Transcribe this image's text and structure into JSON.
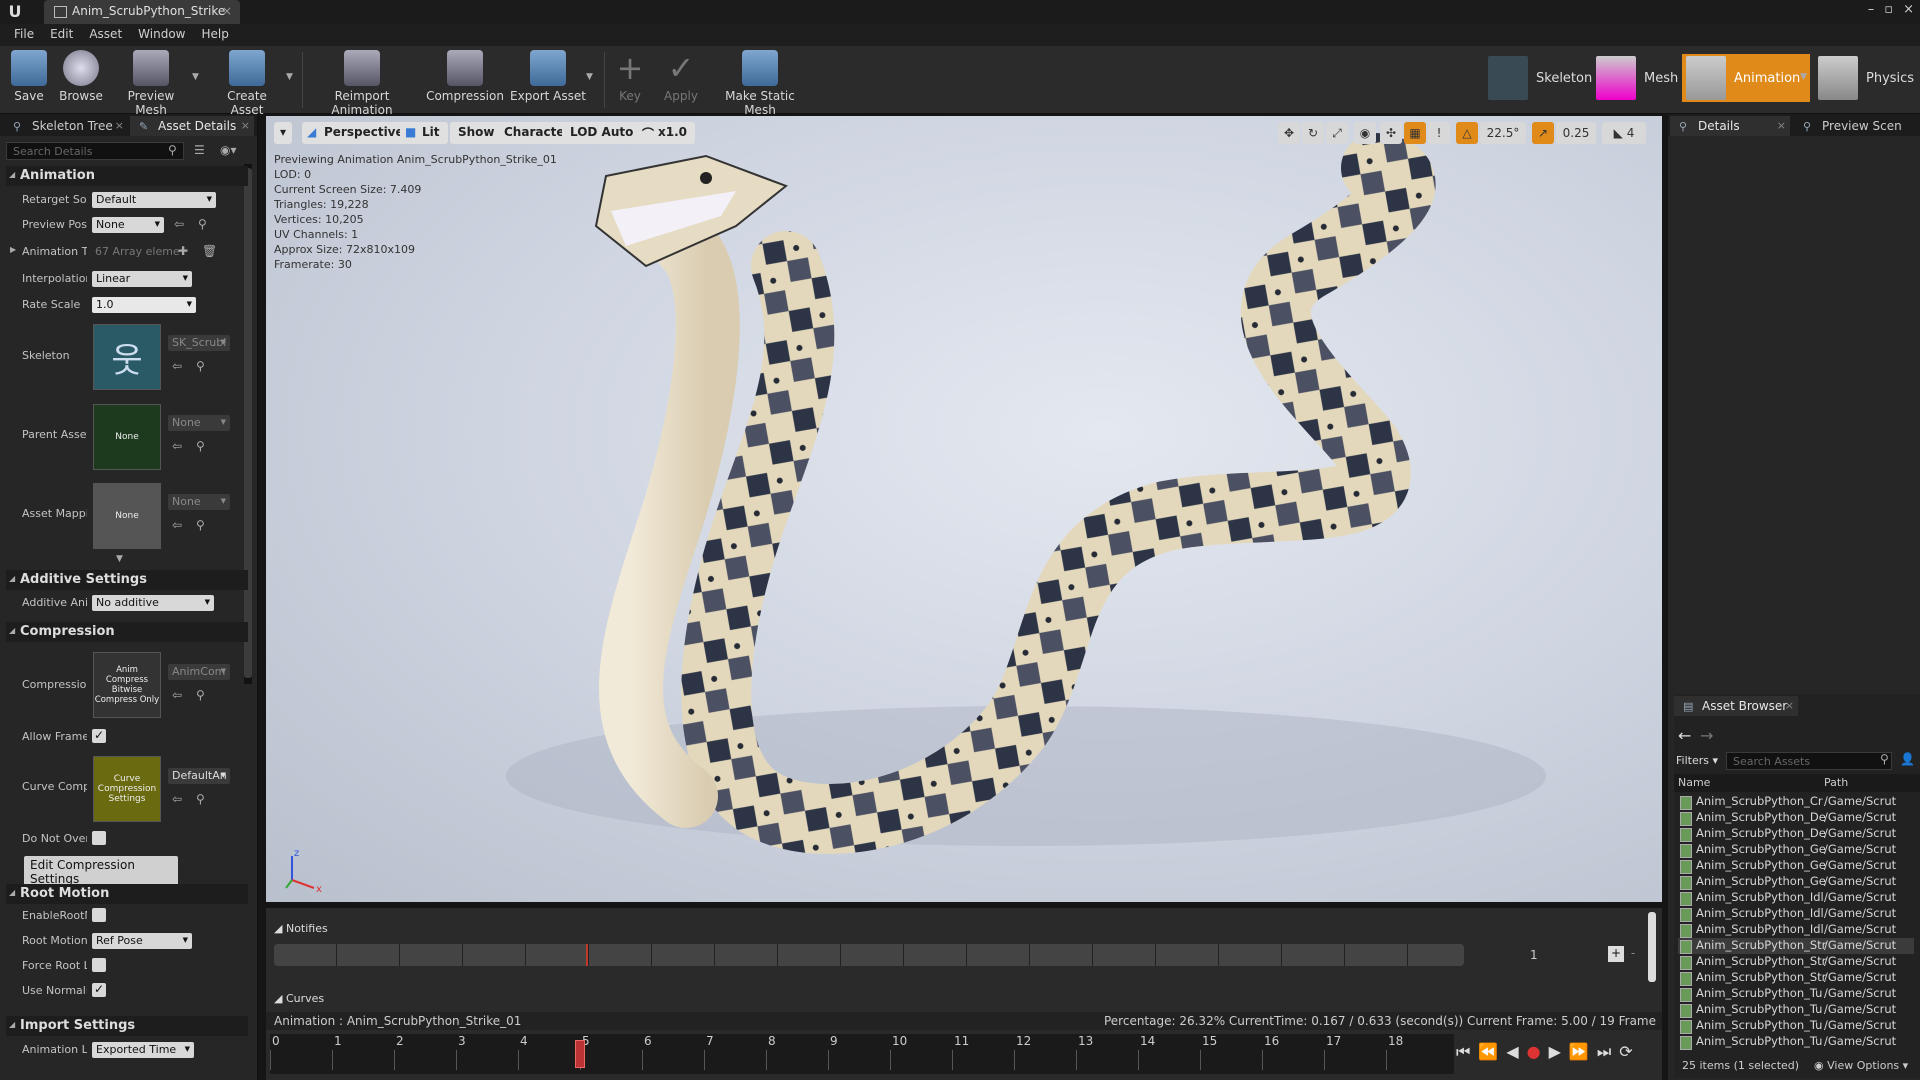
{
  "window": {
    "tab_title": "Anim_ScrubPython_Strike",
    "close": "×",
    "controls": [
      "–",
      "▫",
      "×"
    ]
  },
  "menu": [
    "File",
    "Edit",
    "Asset",
    "Window",
    "Help"
  ],
  "toolbar": {
    "buttons": [
      "Save",
      "Browse",
      "Preview Mesh",
      "Create Asset",
      "Reimport Animation",
      "Compression",
      "Export Asset",
      "Key",
      "Apply",
      "Make Static Mesh"
    ]
  },
  "modes": [
    "Skeleton",
    "Mesh",
    "Animation",
    "Physics"
  ],
  "left_panel": {
    "tabs": [
      "Skeleton Tree",
      "Asset Details"
    ],
    "search_placeholder": "Search Details",
    "sections": {
      "animation": "Animation",
      "additive": "Additive Settings",
      "compression": "Compression",
      "root_motion": "Root Motion",
      "import": "Import Settings"
    },
    "animation": {
      "retarget_label": "Retarget Sou",
      "retarget_value": "Default",
      "preview_pose_label": "Preview Pos",
      "preview_pose_value": "None",
      "anim_tracks_label": "Animation Tr",
      "anim_tracks_value": "67 Array eleme",
      "interpolation_label": "Interpolation",
      "interpolation_value": "Linear",
      "rate_scale_label": "Rate Scale",
      "rate_scale_value": "1.0",
      "skeleton_label": "Skeleton",
      "skeleton_value": "SK_Scrubl",
      "parent_asset_label": "Parent Asset",
      "parent_asset_thumb": "None",
      "parent_asset_value": "None",
      "asset_mapping_label": "Asset Mappi",
      "asset_mapping_thumb": "None",
      "asset_mapping_value": "None"
    },
    "additive": {
      "label": "Additive Anir",
      "value": "No additive"
    },
    "compression": {
      "label": "Compression",
      "thumb": "Anim Compress Bitwise Compress Only",
      "value": "AnimCom",
      "allow_frame_label": "Allow Frame",
      "curve_label": "Curve Compr",
      "curve_thumb": "Curve Compression Settings",
      "curve_value": "DefaultAn",
      "do_not_label": "Do Not Overr",
      "edit_button": "Edit Compression Settings"
    },
    "root_motion": {
      "enable_label": "EnableRootM",
      "root_motion_label": "Root Motion",
      "root_motion_value": "Ref Pose",
      "force_label": "Force Root Lo",
      "use_norm_label": "Use Normaliz"
    },
    "import": {
      "label": "Animation Le",
      "value": "Exported Time"
    }
  },
  "viewport": {
    "buttons": [
      "Perspective",
      "Lit",
      "Show",
      "Character",
      "LOD Auto",
      "x1.0"
    ],
    "info": [
      "Previewing Animation Anim_ScrubPython_Strike_01",
      "LOD: 0",
      "Current Screen Size: 7.409",
      "Triangles: 19,228",
      "Vertices: 10,205",
      "UV Channels: 1",
      "Approx Size: 72x810x109",
      "Framerate: 30"
    ],
    "angle": "22.5°",
    "scale": "0.25",
    "speed": "4"
  },
  "right_panel": {
    "tabs": [
      "Details",
      "Preview Scen"
    ]
  },
  "asset_browser": {
    "tab": "Asset Browser",
    "filters": "Filters",
    "search_placeholder": "Search Assets",
    "columns": [
      "Name",
      "Path"
    ],
    "rows": [
      {
        "name": "Anim_ScrubPython_Cr",
        "path": "/Game/Scrut"
      },
      {
        "name": "Anim_ScrubPython_De",
        "path": "/Game/Scrut"
      },
      {
        "name": "Anim_ScrubPython_De",
        "path": "/Game/Scrut"
      },
      {
        "name": "Anim_ScrubPython_Ge",
        "path": "/Game/Scrut"
      },
      {
        "name": "Anim_ScrubPython_Ge",
        "path": "/Game/Scrut"
      },
      {
        "name": "Anim_ScrubPython_Ge",
        "path": "/Game/Scrut"
      },
      {
        "name": "Anim_ScrubPython_Idl",
        "path": "/Game/Scrut"
      },
      {
        "name": "Anim_ScrubPython_Idl",
        "path": "/Game/Scrut"
      },
      {
        "name": "Anim_ScrubPython_Idl",
        "path": "/Game/Scrut"
      },
      {
        "name": "Anim_ScrubPython_Str",
        "path": "/Game/Scrut",
        "selected": true
      },
      {
        "name": "Anim_ScrubPython_Str",
        "path": "/Game/Scrut"
      },
      {
        "name": "Anim_ScrubPython_Str",
        "path": "/Game/Scrut"
      },
      {
        "name": "Anim_ScrubPython_Tu",
        "path": "/Game/Scrut"
      },
      {
        "name": "Anim_ScrubPython_Tu",
        "path": "/Game/Scrut"
      },
      {
        "name": "Anim_ScrubPython_Tu",
        "path": "/Game/Scrut"
      },
      {
        "name": "Anim_ScrubPython_Tu",
        "path": "/Game/Scrut"
      }
    ],
    "status": "25 items (1 selected)",
    "view_options": "View Options"
  },
  "timeline": {
    "notifies": "Notifies",
    "notify_track_index": "1",
    "curves": "Curves",
    "anim_label": "Animation :  Anim_ScrubPython_Strike_01",
    "status": "Percentage:  26.32% CurrentTime:  0.167 / 0.633 (second(s)) Current Frame:  5.00 / 19 Frame",
    "ticks": [
      "0",
      "1",
      "2",
      "3",
      "4",
      "5",
      "6",
      "7",
      "8",
      "9",
      "10",
      "11",
      "12",
      "13",
      "14",
      "15",
      "16",
      "17",
      "18"
    ],
    "current_frame": 5
  },
  "colors": {
    "accent": "#e08a1a",
    "selection": "#3b3b3b",
    "scrub": "#c0392b"
  }
}
